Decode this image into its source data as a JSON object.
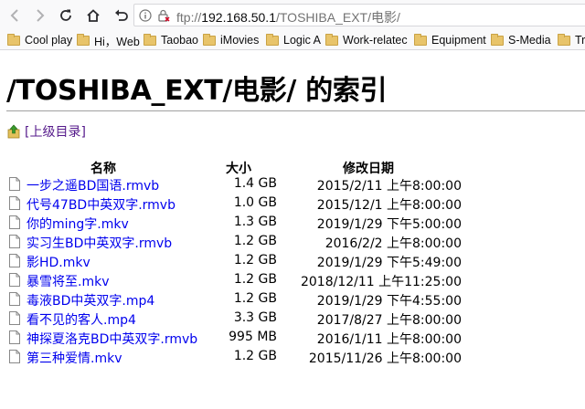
{
  "url": {
    "scheme": "ftp://",
    "host": "192.168.50.1",
    "path": "/TOSHIBA_EXT/电影/"
  },
  "bookmarks": [
    {
      "label": "Cool play"
    },
    {
      "label": "Hi，Web"
    },
    {
      "label": "Taobao"
    },
    {
      "label": "iMovies"
    },
    {
      "label": "Logic A"
    },
    {
      "label": "Work-relatec"
    },
    {
      "label": "Equipment"
    },
    {
      "label": "S-Media"
    },
    {
      "label": "Tri"
    }
  ],
  "page_title": "/TOSHIBA_EXT/电影/ 的索引",
  "parent_link": "[上级目录]",
  "columns": {
    "name": "名称",
    "size": "大小",
    "modified": "修改日期"
  },
  "files": [
    {
      "name": "一步之遥BD国语.rmvb",
      "size": "1.4 GB",
      "date": "2015/2/11 上午8:00:00"
    },
    {
      "name": "代号47BD中英双字.rmvb",
      "size": "1.0 GB",
      "date": "2015/12/1 上午8:00:00"
    },
    {
      "name": "你的ming字.mkv",
      "size": "1.3 GB",
      "date": "2019/1/29 下午5:00:00"
    },
    {
      "name": "实习生BD中英双字.rmvb",
      "size": "1.2 GB",
      "date": "2016/2/2 上午8:00:00"
    },
    {
      "name": "影HD.mkv",
      "size": "1.2 GB",
      "date": "2019/1/29 下午5:49:00"
    },
    {
      "name": "暴雪将至.mkv",
      "size": "1.2 GB",
      "date": "2018/12/11 上午11:25:00"
    },
    {
      "name": "毒液BD中英双字.mp4",
      "size": "1.2 GB",
      "date": "2019/1/29 下午4:55:00"
    },
    {
      "name": "看不见的客人.mp4",
      "size": "3.3 GB",
      "date": "2017/8/27 上午8:00:00"
    },
    {
      "name": "神探夏洛克BD中英双字.rmvb",
      "size": "995 MB",
      "date": "2016/1/11 上午8:00:00"
    },
    {
      "name": "第三种爱情.mkv",
      "size": "1.2 GB",
      "date": "2015/11/26 上午8:00:00"
    }
  ]
}
